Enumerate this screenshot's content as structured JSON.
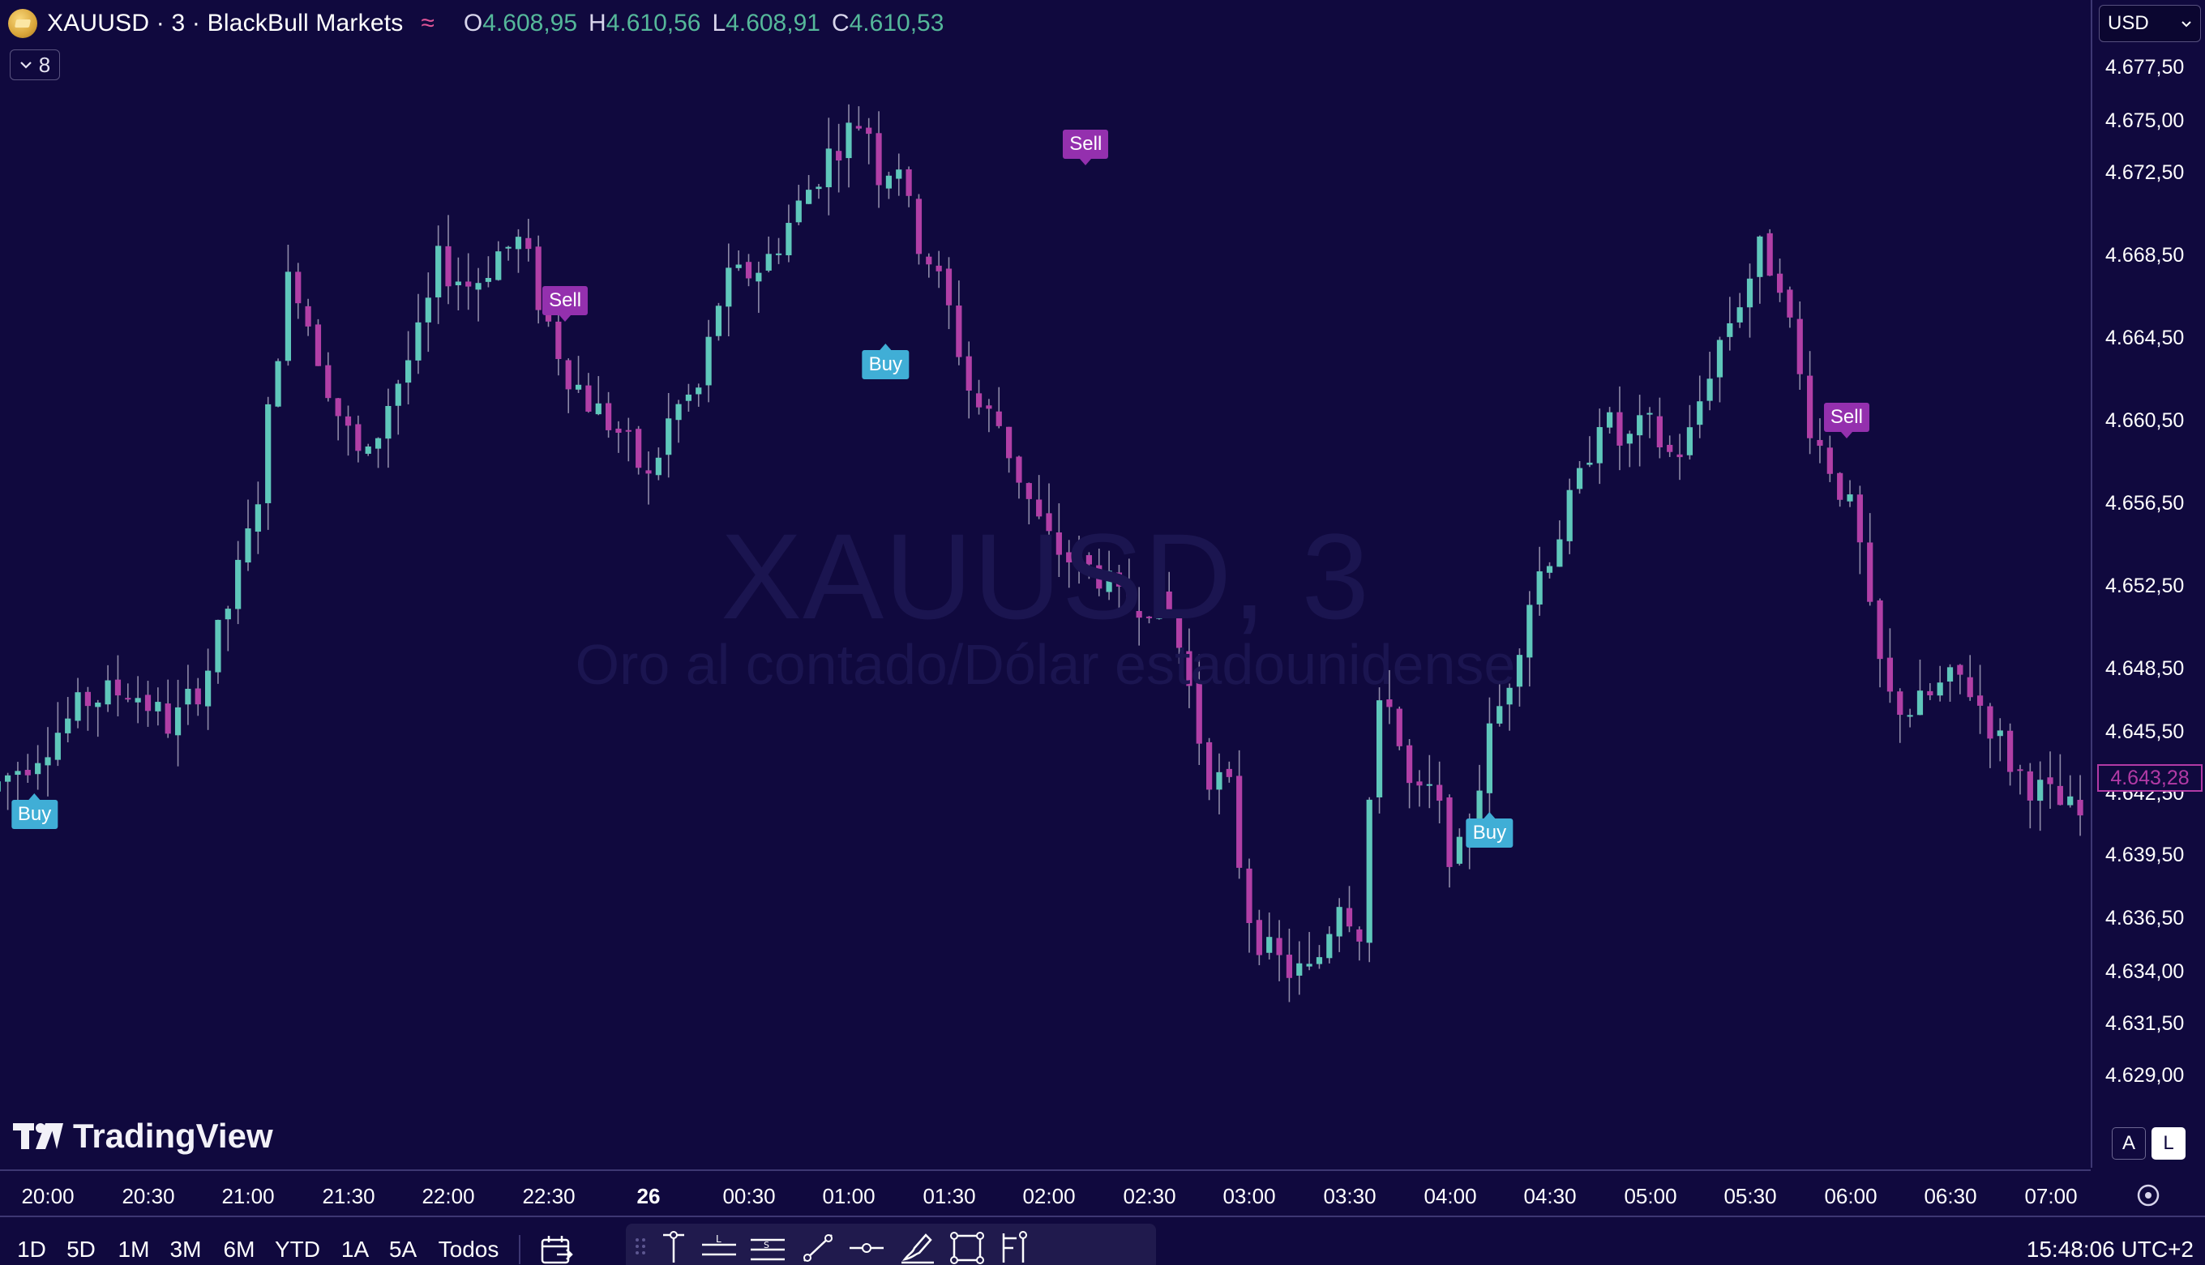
{
  "header": {
    "symbol_title": "XAUUSD · 3 · BlackBull Markets",
    "wave_icon": "≈",
    "ohlc": [
      {
        "key": "O",
        "value": "4.608,95"
      },
      {
        "key": "H",
        "value": "4.610,56"
      },
      {
        "key": "L",
        "value": "4.608,91"
      },
      {
        "key": "C",
        "value": "4.610,53"
      }
    ],
    "indicator_count": "8"
  },
  "watermark": {
    "title": "XAUUSD, 3",
    "subtitle": "Oro al contado/Dólar estadounidense"
  },
  "logo": "TradingView",
  "price_axis": {
    "currency": "USD",
    "current_price": "4.643,28",
    "auto_label": "A",
    "log_label": "L",
    "labels": [
      "4.677,50",
      "4.675,00",
      "4.672,50",
      "4.668,50",
      "4.664,50",
      "4.660,50",
      "4.656,50",
      "4.652,50",
      "4.648,50",
      "4.645,50",
      "4.642,50",
      "4.639,50",
      "4.636,50",
      "4.634,00",
      "4.631,50",
      "4.629,00"
    ]
  },
  "time_axis": {
    "labels": [
      "20:00",
      "20:30",
      "21:00",
      "21:30",
      "22:00",
      "22:30",
      "26",
      "00:30",
      "01:00",
      "01:30",
      "02:00",
      "02:30",
      "03:00",
      "03:30",
      "04:00",
      "04:30",
      "05:00",
      "05:30",
      "06:00",
      "06:30",
      "07:00"
    ]
  },
  "bottom_bar": {
    "ranges": [
      "1D",
      "5D",
      "1M",
      "3M",
      "6M",
      "YTD",
      "1A",
      "5A",
      "Todos"
    ],
    "clock": "15:48:06 UTC+2"
  },
  "signals": [
    {
      "type": "Buy",
      "label": "Buy",
      "time": "19:56",
      "price": 4643.0
    },
    {
      "type": "Sell",
      "label": "Sell",
      "time": "22:35",
      "price": 4665.4
    },
    {
      "type": "Buy",
      "label": "Buy",
      "time": "00:11",
      "price": 4662.6
    },
    {
      "type": "Sell",
      "label": "Sell",
      "time": "01:11",
      "price": 4672.2
    },
    {
      "type": "Buy",
      "label": "Buy",
      "time": "03:12",
      "price": 4642.2
    },
    {
      "type": "Sell",
      "label": "Sell",
      "time": "04:59",
      "price": 4660.3
    }
  ],
  "chart_data": {
    "type": "candlestick",
    "title": "XAUUSD, 3",
    "interval": "3m",
    "xlabel": "",
    "ylabel": "",
    "ylim": [
      4627.6,
      4678.5
    ],
    "x_range": [
      "19:45",
      "07:12"
    ],
    "up_color": "#5fc7bb",
    "down_color": "#b13fa6",
    "path_points": [
      [
        "19:45",
        4644.0
      ],
      [
        "19:58",
        4645.5
      ],
      [
        "20:05",
        4646.5
      ],
      [
        "20:15",
        4648.0
      ],
      [
        "20:28",
        4648.5
      ],
      [
        "20:40",
        4646.8
      ],
      [
        "20:50",
        4649.0
      ],
      [
        "20:58",
        4652.5
      ],
      [
        "21:05",
        4656.0
      ],
      [
        "21:12",
        4663.5
      ],
      [
        "21:16",
        4667.0
      ],
      [
        "21:22",
        4664.0
      ],
      [
        "21:30",
        4660.5
      ],
      [
        "21:38",
        4658.0
      ],
      [
        "21:45",
        4661.0
      ],
      [
        "21:55",
        4664.0
      ],
      [
        "22:00",
        4667.0
      ],
      [
        "22:10",
        4666.0
      ],
      [
        "22:18",
        4667.5
      ],
      [
        "22:25",
        4668.0
      ],
      [
        "22:30",
        4665.5
      ],
      [
        "22:38",
        4662.5
      ],
      [
        "22:45",
        4661.0
      ],
      [
        "22:55",
        4659.5
      ],
      [
        "23:03",
        4657.5
      ],
      [
        "23:10",
        4660.5
      ],
      [
        "23:18",
        4661.5
      ],
      [
        "23:25",
        4666.0
      ],
      [
        "23:38",
        4667.0
      ],
      [
        "23:48",
        4669.5
      ],
      [
        "23:58",
        4672.0
      ],
      [
        "00:08",
        4673.5
      ],
      [
        "00:12",
        4671.0
      ],
      [
        "00:18",
        4671.5
      ],
      [
        "00:22",
        4668.5
      ],
      [
        "00:28",
        4667.0
      ],
      [
        "00:34",
        4664.5
      ],
      [
        "00:40",
        4661.0
      ],
      [
        "00:48",
        4660.0
      ],
      [
        "00:56",
        4657.0
      ],
      [
        "01:02",
        4655.0
      ],
      [
        "01:10",
        4654.0
      ],
      [
        "01:18",
        4653.5
      ],
      [
        "01:25",
        4652.0
      ],
      [
        "01:32",
        4652.5
      ],
      [
        "01:40",
        4651.5
      ],
      [
        "01:45",
        4648.5
      ],
      [
        "01:50",
        4645.0
      ],
      [
        "01:57",
        4644.0
      ],
      [
        "02:02",
        4639.0
      ],
      [
        "02:08",
        4637.0
      ],
      [
        "02:15",
        4636.2
      ],
      [
        "02:22",
        4636.0
      ],
      [
        "02:30",
        4639.5
      ],
      [
        "02:36",
        4638.0
      ],
      [
        "02:40",
        4645.5
      ],
      [
        "02:44",
        4649.0
      ],
      [
        "02:48",
        4646.0
      ],
      [
        "02:52",
        4643.5
      ],
      [
        "02:58",
        4644.0
      ],
      [
        "03:04",
        4641.0
      ],
      [
        "03:08",
        4641.5
      ],
      [
        "03:14",
        4646.0
      ],
      [
        "03:20",
        4648.5
      ],
      [
        "03:28",
        4653.0
      ],
      [
        "03:35",
        4655.0
      ],
      [
        "03:42",
        4657.5
      ],
      [
        "03:48",
        4660.5
      ],
      [
        "03:55",
        4659.0
      ],
      [
        "04:02",
        4660.0
      ],
      [
        "04:10",
        4658.5
      ],
      [
        "04:15",
        4659.5
      ],
      [
        "04:22",
        4663.0
      ],
      [
        "04:30",
        4665.5
      ],
      [
        "04:36",
        4667.5
      ],
      [
        "04:42",
        4666.5
      ],
      [
        "04:48",
        4662.0
      ],
      [
        "04:52",
        4659.5
      ],
      [
        "04:58",
        4658.0
      ],
      [
        "05:05",
        4655.5
      ],
      [
        "05:10",
        4650.5
      ],
      [
        "05:15",
        4648.0
      ],
      [
        "05:22",
        4647.5
      ],
      [
        "05:30",
        4648.5
      ],
      [
        "05:37",
        4649.0
      ],
      [
        "05:45",
        4647.0
      ],
      [
        "05:52",
        4645.0
      ],
      [
        "06:00",
        4644.0
      ],
      [
        "06:10",
        4643.0
      ],
      [
        "06:22",
        4642.0
      ],
      [
        "06:35",
        4641.5
      ],
      [
        "06:42",
        4640.5
      ],
      [
        "06:50",
        4640.0
      ],
      [
        "06:58",
        4641.5
      ],
      [
        "07:05",
        4643.0
      ],
      [
        "07:12",
        4643.3
      ]
    ]
  }
}
